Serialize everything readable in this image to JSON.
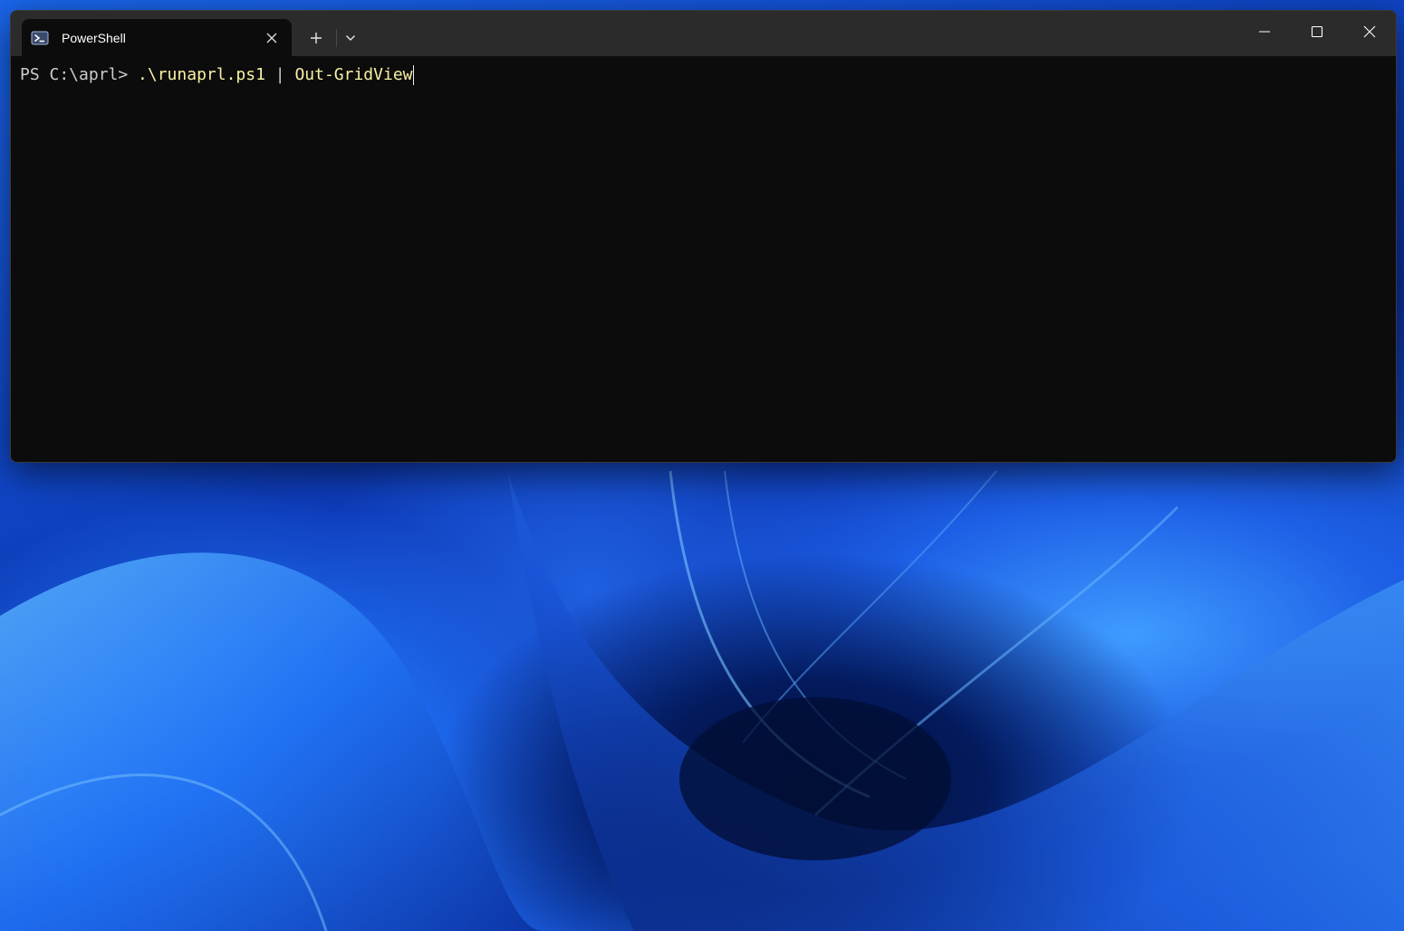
{
  "window": {
    "tab_title": "PowerShell",
    "tab_icon": "powershell-icon",
    "new_tab_label": "+",
    "colors": {
      "titlebar": "#2b2b2b",
      "terminal_bg": "#0c0c0c",
      "prompt_text": "#cccccc",
      "command_text": "#f9f1a5"
    }
  },
  "terminal": {
    "prompt": "PS C:\\aprl> ",
    "command_script": ".\\runaprl.ps1",
    "pipe": " | ",
    "command_cmdlet": "Out-GridView"
  }
}
